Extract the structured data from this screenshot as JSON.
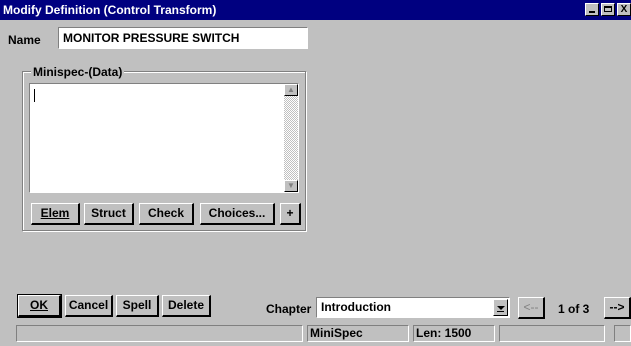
{
  "window": {
    "title": "Modify  Definition (Control Transform)",
    "minimize_glyph": "",
    "maximize_glyph": "",
    "close_glyph": "X"
  },
  "name_field": {
    "label": "Name",
    "value": "MONITOR PRESSURE SWITCH"
  },
  "minispec": {
    "legend": "Minispec-(Data)",
    "content": "",
    "buttons": {
      "elem": "Elem",
      "struct": "Struct",
      "check": "Check",
      "choices": "Choices...",
      "plus": "+"
    }
  },
  "footer": {
    "ok": "OK",
    "cancel": "Cancel",
    "spell": "Spell",
    "delete": "Delete",
    "chapter_label": "Chapter",
    "chapter_value": "Introduction",
    "prev": "<--",
    "page": "1 of 3",
    "next": "-->"
  },
  "status_bar": {
    "cells": [
      "",
      "MiniSpec",
      "Len: 1500",
      "",
      ""
    ]
  }
}
